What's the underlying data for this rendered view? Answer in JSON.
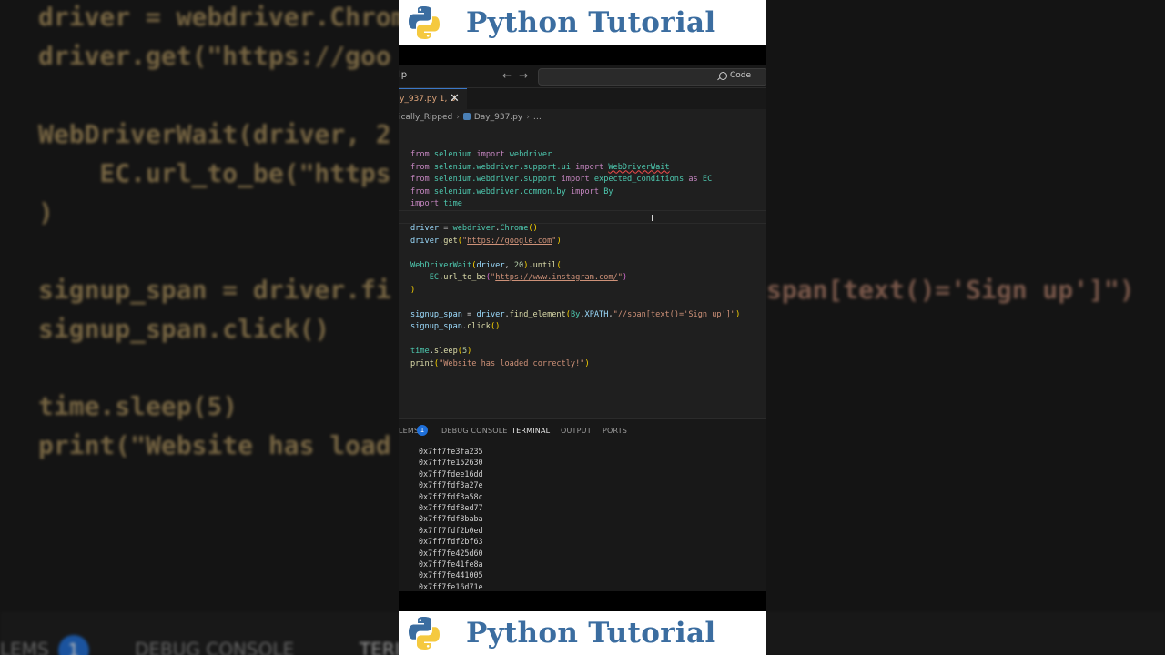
{
  "banner": {
    "title": "Python Tutorial"
  },
  "background": {
    "code_lines": [
      "driver = webdriver.Chrome",
      "driver.get(\"https://goo",
      "",
      "WebDriverWait(driver, 2",
      "    EC.url_to_be(\"https",
      ")",
      "",
      "signup_span = driver.fi",
      "signup_span.click()",
      "",
      "time.sleep(5)",
      "print(\"Website has load"
    ],
    "right_fragment": "span[text()='Sign up']\")",
    "panel_items": [
      "LEMS",
      "1",
      "DEBUG CONSOLE",
      "TERI"
    ]
  },
  "titlebar": {
    "left_text": "lp",
    "back_arrow": "←",
    "forward_arrow": "→",
    "search_label": "Code"
  },
  "tab": {
    "label": "y_937.py 1, U",
    "close": "✕"
  },
  "breadcrumb": {
    "folder": "ically_Ripped",
    "separator": "›",
    "file": "Day_937.py",
    "more": "…"
  },
  "panel": {
    "tabs": [
      "LEMS",
      "DEBUG CONSOLE",
      "TERMINAL",
      "OUTPUT",
      "PORTS"
    ],
    "active_tab": "TERMINAL",
    "problems_count": "1",
    "terminal_lines": [
      "0x7ff7fe3fa235",
      "0x7ff7fe152630",
      "0x7ff7fdee16dd",
      "0x7ff7fdf3a27e",
      "0x7ff7fdf3a58c",
      "0x7ff7fdf8ed77",
      "0x7ff7fdf8baba",
      "0x7ff7fdf2b0ed",
      "0x7ff7fdf2bf63",
      "0x7ff7fe425d60",
      "0x7ff7fe41fe8a",
      "0x7ff7fe441005",
      "0x7ff7fe16d71e"
    ]
  },
  "icons": {
    "logo": "python-logo-icon",
    "search": "search-icon",
    "python_file": "python-file-icon"
  }
}
